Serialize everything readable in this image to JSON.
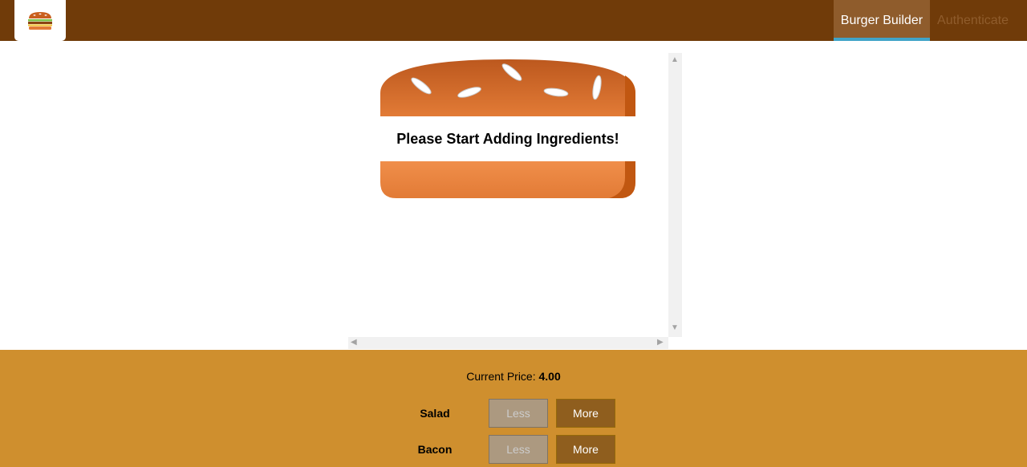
{
  "toolbar": {
    "logo_icon": "burger-logo-icon",
    "nav": [
      {
        "label": "Burger Builder",
        "active": true
      },
      {
        "label": "Authenticate",
        "active": false
      }
    ]
  },
  "burger": {
    "message": "Please Start Adding Ingredients!"
  },
  "controls": {
    "price_label": "Current Price:",
    "price_value": "4.00",
    "rows": [
      {
        "label": "Salad",
        "less_label": "Less",
        "more_label": "More"
      },
      {
        "label": "Bacon",
        "less_label": "Less",
        "more_label": "More"
      }
    ]
  },
  "colors": {
    "toolbar": "#703B09",
    "nav_active_bg": "#8F5C2C",
    "nav_active_border": "#40A4C8",
    "controls_bg": "#CF8F2E",
    "more_button": "#8F5E1E",
    "less_button_disabled": "#AC9980",
    "bread": "#E27B36"
  }
}
